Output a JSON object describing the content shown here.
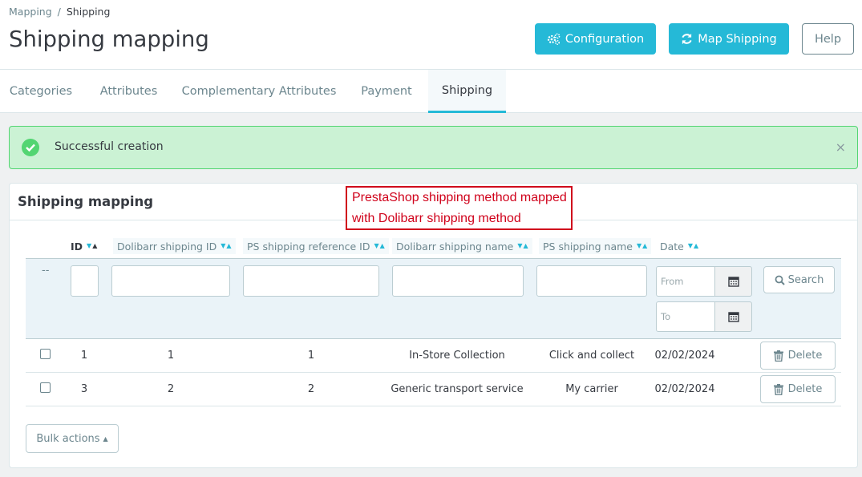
{
  "breadcrumb": {
    "parent": "Mapping",
    "separator": "/",
    "current": "Shipping"
  },
  "page_title": "Shipping mapping",
  "toolbar": {
    "configuration_label": "Configuration",
    "map_shipping_label": "Map Shipping",
    "help_label": "Help"
  },
  "tabs": [
    {
      "label": "Categories"
    },
    {
      "label": "Attributes"
    },
    {
      "label": "Complementary Attributes"
    },
    {
      "label": "Payment"
    },
    {
      "label": "Shipping"
    }
  ],
  "alert": {
    "message": "Successful creation",
    "close": "×"
  },
  "panel": {
    "title": "Shipping mapping"
  },
  "annotation": {
    "line1": "PrestaShop shipping method mapped",
    "line2": "with Dolibarr shipping method"
  },
  "table": {
    "columns": {
      "id": "ID",
      "dolibarr_shipping_id": "Dolibarr shipping ID",
      "ps_shipping_reference_id": "PS shipping reference ID",
      "dolibarr_shipping_name": "Dolibarr shipping name",
      "ps_shipping_name": "PS shipping name",
      "date": "Date"
    },
    "filters": {
      "bulk_placeholder": "--",
      "from_placeholder": "From",
      "to_placeholder": "To",
      "search_label": "Search"
    },
    "rows": [
      {
        "id": "1",
        "dolibarr_shipping_id": "1",
        "ps_shipping_reference_id": "1",
        "dolibarr_shipping_name": "In-Store Collection",
        "ps_shipping_name": "Click and collect",
        "date": "02/02/2024",
        "action": "Delete"
      },
      {
        "id": "3",
        "dolibarr_shipping_id": "2",
        "ps_shipping_reference_id": "2",
        "dolibarr_shipping_name": "Generic transport service",
        "ps_shipping_name": "My carrier",
        "date": "02/02/2024",
        "action": "Delete"
      }
    ]
  },
  "bulk_actions_label": "Bulk actions",
  "icons": {
    "configuration": "gears-icon",
    "map_shipping": "refresh-icon",
    "alert": "check-circle-icon",
    "search": "search-icon",
    "calendar": "calendar-icon",
    "delete": "trash-icon"
  },
  "colors": {
    "primary": "#25b9d7",
    "success_bg": "#cbf2d4",
    "success_border": "#53d572",
    "annotation": "#d0021b"
  }
}
